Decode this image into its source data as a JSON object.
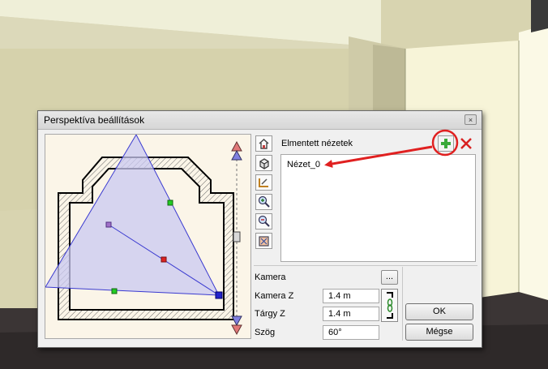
{
  "dialog": {
    "title": "Perspektíva beállítások",
    "close_glyph": "×"
  },
  "toolbar": {
    "icons": [
      "home-view-icon",
      "3d-box-icon",
      "edit-plan-icon",
      "zoom-in-icon",
      "zoom-out-icon",
      "zoom-fit-icon"
    ]
  },
  "saved_views": {
    "label": "Elmentett nézetek",
    "items": [
      "Nézet_0"
    ]
  },
  "fields": {
    "camera_label": "Kamera",
    "camera_browse": "...",
    "camera_z_label": "Kamera Z",
    "camera_z_value": "1.4 m",
    "target_z_label": "Tárgy Z",
    "target_z_value": "1.4 m",
    "angle_label": "Szög",
    "angle_value": "60°"
  },
  "buttons": {
    "ok": "OK",
    "cancel": "Mégse"
  },
  "colors": {
    "accent_red": "#e02020",
    "view_cone": "#c9c8f2",
    "plus_green": "#3aa83a"
  }
}
